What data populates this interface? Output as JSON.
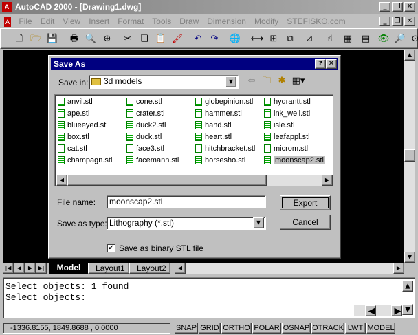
{
  "window": {
    "title": "AutoCAD 2000 - [Drawing1.dwg]",
    "min": "_",
    "restore": "❐",
    "close": "✕"
  },
  "menu": [
    "File",
    "Edit",
    "View",
    "Insert",
    "Format",
    "Tools",
    "Draw",
    "Dimension",
    "Modify",
    "STEFISKO.com"
  ],
  "dialog": {
    "title": "Save As",
    "help": "?",
    "close": "✕",
    "save_in_label": "Save in:",
    "save_in_value": "3d models",
    "columns": [
      [
        "anvil.stl",
        "ape.stl",
        "blueeyed.stl",
        "box.stl",
        "cat.stl",
        "champagn.stl"
      ],
      [
        "cone.stl",
        "crater.stl",
        "duck2.stl",
        "duck.stl",
        "face3.stl",
        "facemann.stl"
      ],
      [
        "globepinion.stl",
        "hammer.stl",
        "hand.stl",
        "heart.stl",
        "hitchbracket.stl",
        "horsesho.stl"
      ],
      [
        "hydrantt.stl",
        "ink_well.stl",
        "isle.stl",
        "leafappl.stl",
        "microm.stl",
        "moonscap2.stl"
      ]
    ],
    "filename_label": "File name:",
    "filename_value": "moonscap2.stl",
    "savetype_label": "Save as type:",
    "savetype_value": "Lithography (*.stl)",
    "export_label": "Export",
    "cancel_label": "Cancel",
    "binary_label": "Save as binary STL file",
    "binary_checked": true
  },
  "tabs": [
    "Model",
    "Layout1",
    "Layout2"
  ],
  "command": [
    "Select objects: 1 found",
    "Select objects:"
  ],
  "status": {
    "coords": "-1336.8155, 1849.8688 , 0.0000",
    "buttons": [
      "SNAP",
      "GRID",
      "ORTHO",
      "POLAR",
      "OSNAP",
      "OTRACK",
      "LWT",
      "MODEL"
    ]
  }
}
